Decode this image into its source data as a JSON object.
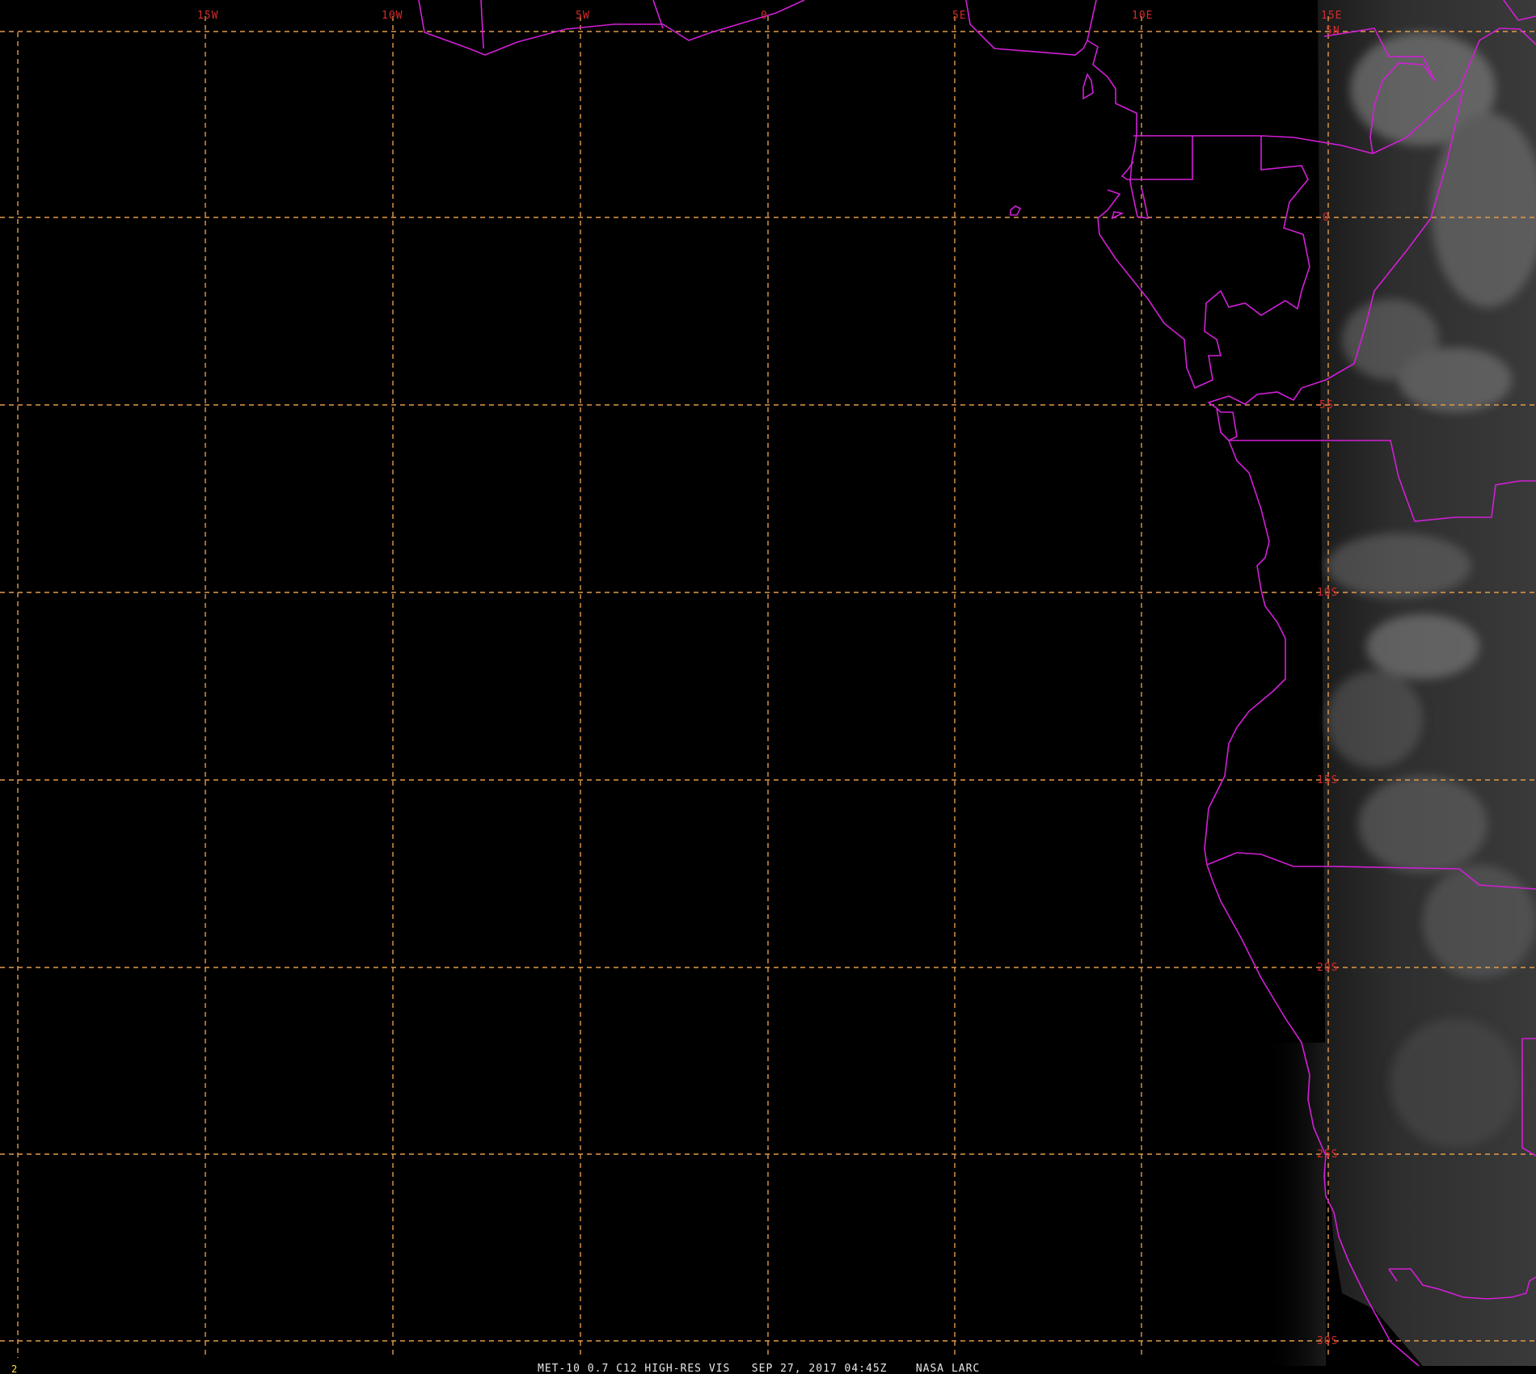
{
  "map": {
    "longitude_labels": [
      "15W",
      "10W",
      "5W",
      "0",
      "5E",
      "10E",
      "15E"
    ],
    "latitude_labels": [
      "5N",
      "0",
      "5S",
      "10S",
      "15S",
      "20S",
      "25S",
      "30S"
    ]
  },
  "footer": {
    "frame_number": "2",
    "caption": "MET-10 0.7 C12 HIGH-RES VIS   SEP 27, 2017 04:45Z    NASA LARC"
  },
  "colors": {
    "background": "#000000",
    "grid": "#e39a4a",
    "borders": "#d21fd6",
    "labels": "#d42a2a",
    "frame": "#ffe34d"
  }
}
